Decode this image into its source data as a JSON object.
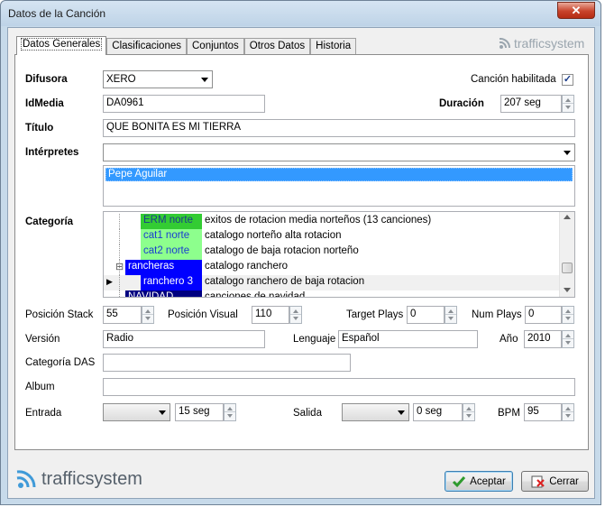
{
  "window": {
    "title": "Datos de la Canción",
    "close_glyph": "✕"
  },
  "tabs": [
    "Datos Generales",
    "Clasificaciones",
    "Conjuntos",
    "Otros Datos",
    "Historia"
  ],
  "brand": {
    "name": "trafficsystem"
  },
  "fields": {
    "difusora": {
      "label": "Difusora",
      "value": "XERO"
    },
    "cancion_habilitada": {
      "label": "Canción habilitada",
      "checked": true,
      "glyph": "✓"
    },
    "idmedia": {
      "label": "IdMedia",
      "value": "DA0961"
    },
    "duracion": {
      "label": "Duración",
      "value": "207 seg"
    },
    "titulo": {
      "label": "Título",
      "value": "QUE BONITA ES MI TIERRA"
    },
    "interpretes": {
      "label": "Intérpretes",
      "value": "",
      "list": [
        "Pepe Aguilar"
      ]
    },
    "categoria": {
      "label": "Categoría",
      "rows": [
        {
          "code": "ERM norte",
          "desc": "exitos de rotacion media norteños (13 canciones)",
          "code_bg": "#33cc33",
          "code_fg": "#1a3c8a"
        },
        {
          "code": "cat1 norte",
          "desc": "catalogo norteño alta rotacion",
          "code_bg": "#8dff8d",
          "code_fg": "#1a3cd0"
        },
        {
          "code": "cat2 norte",
          "desc": "catalogo de baja rotacion norteño",
          "code_bg": "#8dff8d",
          "code_fg": "#1a3cd0"
        },
        {
          "code": "rancheras",
          "desc": "catalogo ranchero",
          "code_bg": "#0000ff",
          "code_fg": "#ffffff",
          "expander": "⊟"
        },
        {
          "code": "ranchero 3",
          "desc": "catalogo ranchero de baja rotacion",
          "code_bg": "#0000ff",
          "code_fg": "#ffffff",
          "current": true,
          "pointer": "▶"
        },
        {
          "code": "NAVIDAD",
          "desc": "canciones de navidad",
          "code_bg": "#000080",
          "code_fg": "#ffffff"
        }
      ]
    },
    "posicion_stack": {
      "label": "Posición Stack",
      "value": "55"
    },
    "posicion_visual": {
      "label": "Posición Visual",
      "value": "110"
    },
    "target_plays": {
      "label": "Target Plays",
      "value": "0"
    },
    "num_plays": {
      "label": "Num Plays",
      "value": "0"
    },
    "version": {
      "label": "Versión",
      "value": "Radio"
    },
    "lenguaje": {
      "label": "Lenguaje",
      "value": "Español"
    },
    "anio": {
      "label": "Año",
      "value": "2010"
    },
    "categoria_das": {
      "label": "Categoría DAS",
      "value": ""
    },
    "album": {
      "label": "Album",
      "value": ""
    },
    "entrada": {
      "label": "Entrada",
      "value": "",
      "seconds": "15 seg"
    },
    "salida": {
      "label": "Salida",
      "value": "",
      "seconds": "0 seg"
    },
    "bpm": {
      "label": "BPM",
      "value": "95"
    }
  },
  "buttons": {
    "aceptar": "Aceptar",
    "cerrar": "Cerrar"
  }
}
